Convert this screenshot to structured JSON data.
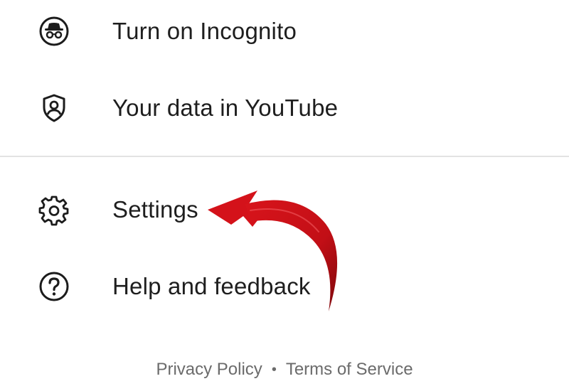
{
  "menu": {
    "items": [
      {
        "label": "Turn on Incognito",
        "icon": "incognito-icon"
      },
      {
        "label": "Your data in YouTube",
        "icon": "shield-person-icon"
      },
      {
        "label": "Settings",
        "icon": "gear-icon"
      },
      {
        "label": "Help and feedback",
        "icon": "help-circle-icon"
      }
    ]
  },
  "footer": {
    "privacy": "Privacy Policy",
    "separator": "•",
    "terms": "Terms of Service"
  },
  "annotation": {
    "arrow_color": "#c80f16",
    "arrow_icon": "curved-red-arrow-icon"
  }
}
